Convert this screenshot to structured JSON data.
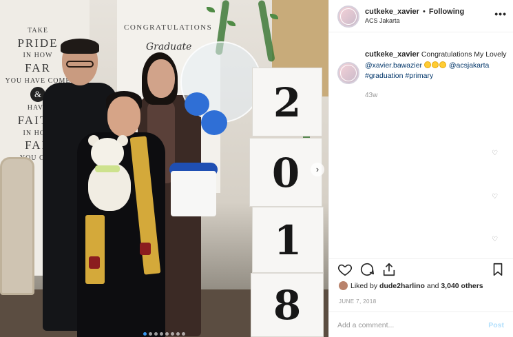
{
  "post": {
    "username": "cutkeke_xavier",
    "separator": "•",
    "follow_status": "Following",
    "location": "ACS Jakarta",
    "more_glyph": "•••"
  },
  "caption": {
    "username": "cutkeke_xavier",
    "text_before": "Congratulations My Lovely",
    "mention_user": "@xavier.bawazier",
    "mention_school": "@acsjakarta",
    "hashtag_1": "#graduation",
    "hashtag_2": "#primary",
    "time_ago": "43w"
  },
  "photo_text": {
    "take": "TAKE",
    "pride": "PRIDE",
    "in_how": "IN HOW",
    "far": "FAR",
    "you_have_come": "YOU HAVE COME",
    "and": "&",
    "have": "HAVE",
    "faith": "FAITH",
    "in_how_2": "IN HOW",
    "far_2": "FAR",
    "you_can": "YOU CAN",
    "congratulations": "CONGRATULATIONS",
    "graduate": "Graduate",
    "year_digits": [
      "2",
      "0",
      "1",
      "8"
    ]
  },
  "engagement": {
    "liked_by_prefix": "Liked by",
    "liked_by_user": "dude2harlino",
    "and_word": "and",
    "others": "3,040 others",
    "date": "JUNE 7, 2018"
  },
  "comment_box": {
    "placeholder": "Add a comment...",
    "post_label": "Post"
  },
  "carousel": {
    "total_slides": 8,
    "active_index": 0,
    "next_glyph": "›"
  },
  "comment_like_glyph": "♡",
  "colors": {
    "link": "#003569",
    "muted": "#999999",
    "post_disabled": "#b2dffc",
    "active_dot": "#3897f0",
    "stole_gold": "#d4a93a"
  },
  "icons": [
    "heart-icon",
    "comment-icon",
    "share-icon",
    "bookmark-icon",
    "more-icon"
  ]
}
